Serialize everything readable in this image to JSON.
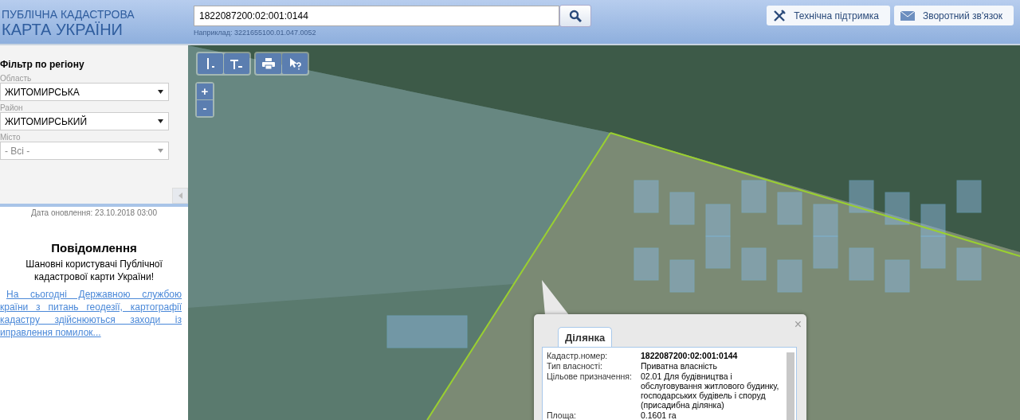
{
  "header": {
    "logo_line_1": "ПУБЛІЧНА КАДАСТРОВА",
    "logo_line_2": "КАРТА УКРАЇНИ",
    "search": {
      "value": "1822087200:02:001:0144",
      "hint": "Наприклад: 3221655100.01.047.0052"
    },
    "buttons": [
      {
        "label": "Технічна підтримка",
        "kind": "support"
      },
      {
        "label": "Зворотний зв'язок",
        "kind": "feedback"
      }
    ]
  },
  "sidebar": {
    "filter_title": "Фільтр по регіону",
    "fields": [
      {
        "label": "Область",
        "value": "ЖИТОМИРСЬКА",
        "disabled": false
      },
      {
        "label": "Район",
        "value": "ЖИТОМИРСЬКИЙ",
        "disabled": false
      },
      {
        "label": "Місто",
        "value": "- Всі -",
        "disabled": true
      }
    ],
    "update_date": "Дата оновлення: 23.10.2018 03:00",
    "notice": {
      "title": "Повідомлення",
      "greeting": "Шановні користувачі Публічної кадастрової карти України!",
      "link": "На сьогодні Державною службою країни з питань геодезії, картографії кадастру здійснюються заходи із иправлення помилок..."
    }
  },
  "map": {
    "tools": [
      {
        "kind": "distance"
      },
      {
        "kind": "area"
      },
      {
        "kind": "print"
      },
      {
        "kind": "identify"
      }
    ],
    "zoom_in": "+",
    "zoom_out": "-",
    "popup": {
      "tab": "Ділянка",
      "close": "×",
      "rows": [
        {
          "label": "Кадастр.номер:",
          "value": "1822087200:02:001:0144",
          "bold": true
        },
        {
          "label": "Тип власності:",
          "value": "Приватна власність",
          "bold": false
        },
        {
          "label": "Цільове призначення:",
          "value": "02.01 Для будівництва і обслуговування житлового будинку, господарських будівель і споруд (присадибна ділянка)",
          "bold": false
        },
        {
          "label": "Площа:",
          "value": "0.1601 га",
          "bold": false
        }
      ]
    }
  }
}
